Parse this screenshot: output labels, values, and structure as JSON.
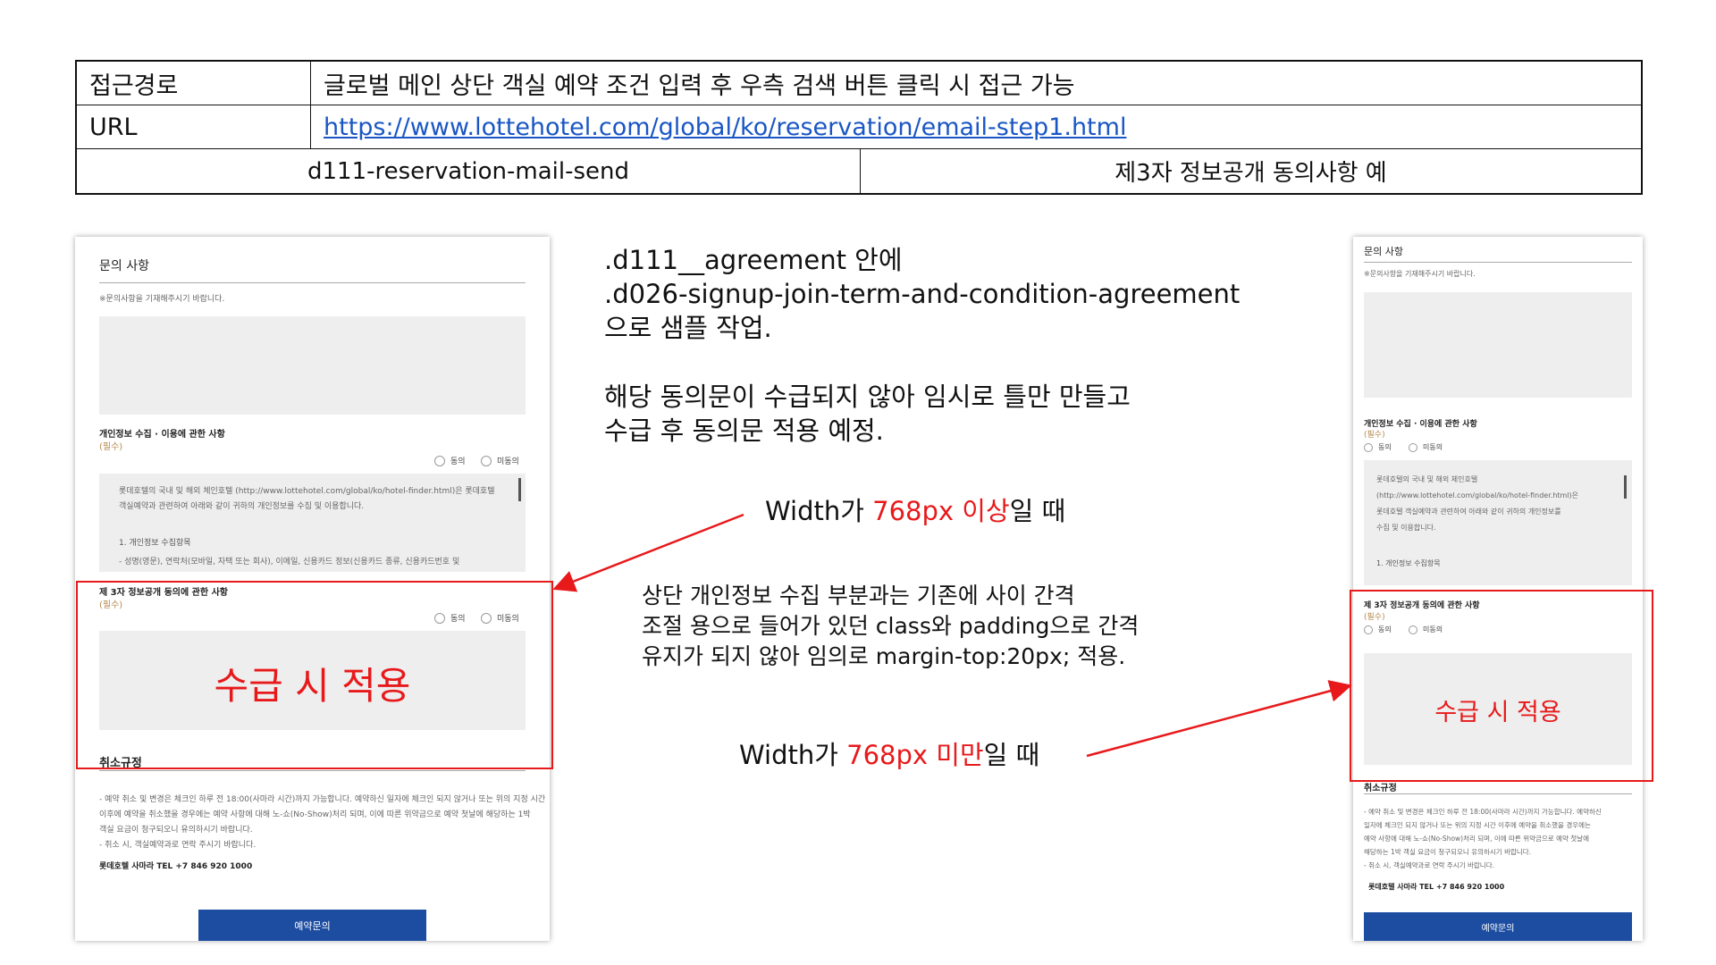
{
  "info_table": {
    "route_label": "접근경로",
    "route_value": "글로벌 메인 상단 객실 예약 조건 입력 후 우측 검색 버튼 클릭 시 접근 가능",
    "url_label": "URL",
    "url_value": "https://www.lottehotel.com/global/ko/reservation/email-step1.html",
    "page_id": "d111-reservation-mail-send",
    "description": "제3자 정보공개 동의사항 예"
  },
  "form": {
    "inquiry_title": "문의 사항",
    "inquiry_hint": "※문의사항을 기재해주시기 바랍니다.",
    "privacy_title": "개인정보 수집 · 이용에 관한 사항",
    "required": "(필수)",
    "agree": "동의",
    "disagree": "미동의",
    "privacy_text_1": "롯데호텔의 국내 및 해외 체인호텔 (http://www.lottehotel.com/global/ko/hotel-finder.html)은 롯데호텔 객실예약과 관련하여 아래와 같이 귀하의 개인정보를 수집 및 이용합니다.",
    "privacy_item_title": "1. 개인정보 수집항목",
    "privacy_item_text": "- 성명(영문), 연락처(모바일, 자택 또는 회사), 이메일, 신용카드 정보(신용카드 종류, 신용카드번호 및",
    "mobile_privacy_item_title": "1. 개인정보 수집항목",
    "third_party_title": "제 3자 정보공개 동의에 관한 사항",
    "apply_placeholder": "수급 시 적용",
    "cancel_title": "취소규정",
    "cancel_text_1": "- 예약 취소 및 변경은 체크인 하루 전 18:00(사마라 시간)까지 가능합니다. 예약하신 일자에 체크인 되지 않거나 또는 위의 지정 시간",
    "cancel_text_2": "이후에 예약을 취소했을 경우에는 예약 사항에 대해 노-쇼(No-Show)처리 되며, 이에 따른 위약금으로 예약 첫날에 해당하는 1박",
    "cancel_text_3": "객실 요금이 청구되오니 유의하시기 바랍니다.",
    "cancel_text_4": "- 취소 시, 객실예약과로 연락 주시기 바랍니다.",
    "mobile_cancel_lines": [
      "- 예약 취소 및 변경은 체크인 하루 전 18:00(사마라 시간)까지 가능합니다. 예약하신",
      "일자에 체크인 되지 않거나 또는 위의 지정 시간 이후에 예약을 취소했을 경우에는",
      "예약 사항에 대해 노-쇼(No-Show)처리 되며, 이에 따른 위약금으로 예약 첫날에",
      "해당하는 1박 객실 요금이 청구되오니 유의하시기 바랍니다.",
      "- 취소 시, 객실예약과로 연락 주시기 바랍니다."
    ],
    "mobile_privacy_lines": [
      "롯데호텔의 국내 및 해외 체인호텔",
      "(http://www.lottehotel.com/global/ko/hotel-finder.html)은",
      "롯데호텔 객실예약과 관련하여 아래와 같이 귀하의 개인정보를",
      "수집 및 이용합니다."
    ],
    "tel": "롯데호텔 사마라 TEL +7 846 920 1000",
    "submit_button": "예약문의"
  },
  "notes": {
    "line1": ".d111__agreement 안에",
    "line2": ".d026-signup-join-term-and-condition-agreement",
    "line3": "으로 샘플 작업.",
    "line4": "해당 동의문이 수급되지 않아 임시로 틀만 만들고",
    "line5": "수급 후 동의문 적용 예정.",
    "wide_prefix": "Width가 ",
    "wide_red": "768px 이상",
    "wide_suffix": "일 때",
    "mid1": "상단 개인정보 수집 부분과는 기존에 사이 간격",
    "mid2": "조절 용으로 들어가 있던 class와 padding으로 간격",
    "mid3": "유지가 되지 않아 임의로 margin-top:20px; 적용.",
    "narrow_prefix": "Width가 ",
    "narrow_red": "768px 미만",
    "narrow_suffix": "일 때"
  },
  "colors": {
    "highlight": "#e8191b",
    "button": "#1c4da1",
    "link": "#1a56c4"
  }
}
